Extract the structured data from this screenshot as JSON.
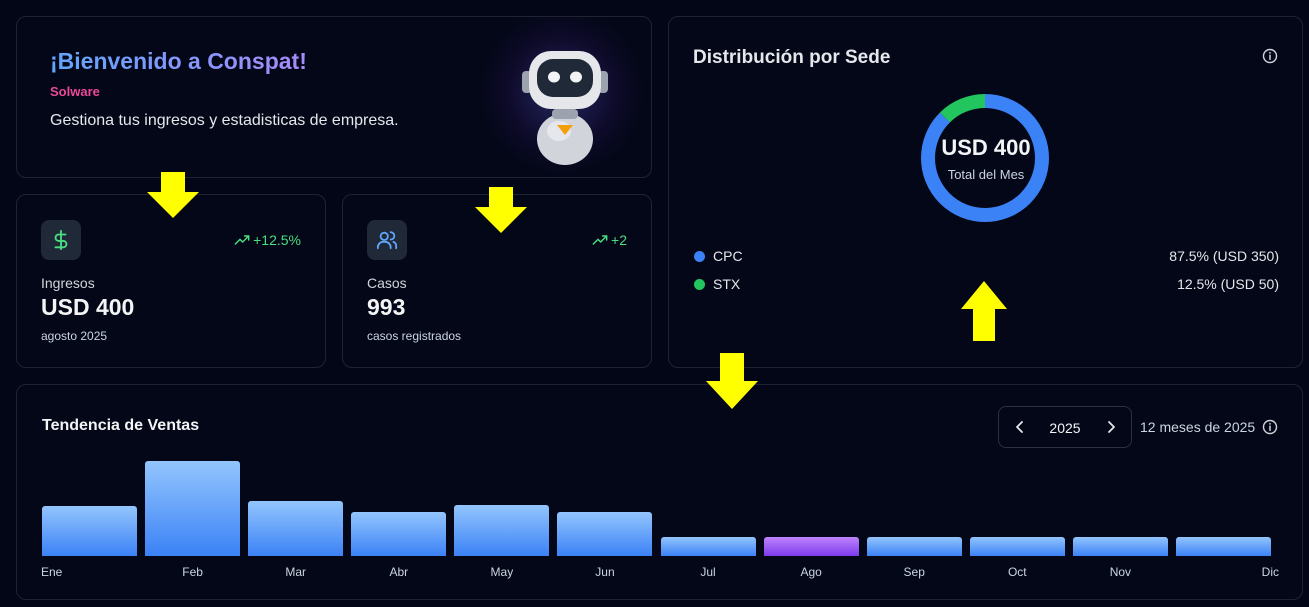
{
  "welcome": {
    "title": "¡Bienvenido a Conspat!",
    "company": "Solware",
    "description": "Gestiona tus ingresos y estadisticas de empresa."
  },
  "stats": {
    "income": {
      "icon": "dollar-icon",
      "trend": "+12.5%",
      "label": "Ingresos",
      "value": "USD 400",
      "sub": "agosto 2025"
    },
    "cases": {
      "icon": "users-icon",
      "trend": "+2",
      "label": "Casos",
      "value": "993",
      "sub": "casos registrados"
    }
  },
  "distribution": {
    "title": "Distribución por Sede",
    "total_value": "USD 400",
    "total_label": "Total del Mes",
    "items": [
      {
        "name": "CPC",
        "value": "87.5% (USD 350)",
        "fraction": 0.875,
        "color": "#3b82f6"
      },
      {
        "name": "STX",
        "value": "12.5% (USD 50)",
        "fraction": 0.125,
        "color": "#22c55e"
      }
    ]
  },
  "trend": {
    "title": "Tendencia de Ventas",
    "year": "2025",
    "months_note": "12 meses de 2025",
    "current_month_index": 7
  },
  "chart_data": {
    "type": "bar",
    "categories": [
      "Ene",
      "Feb",
      "Mar",
      "Abr",
      "May",
      "Jun",
      "Jul",
      "Ago",
      "Sep",
      "Oct",
      "Nov",
      "Dic"
    ],
    "values": [
      50,
      95,
      55,
      44,
      51,
      44,
      19,
      19,
      19,
      19,
      19,
      19
    ],
    "title": "Tendencia de Ventas",
    "ylim": [
      0,
      95
    ]
  },
  "colors": {
    "accent": "#3b82f6",
    "trend_positive": "#4ade80",
    "brand_pink": "#ec4899",
    "current_month": "#8b5cf6",
    "arrow": "#ffff00"
  }
}
